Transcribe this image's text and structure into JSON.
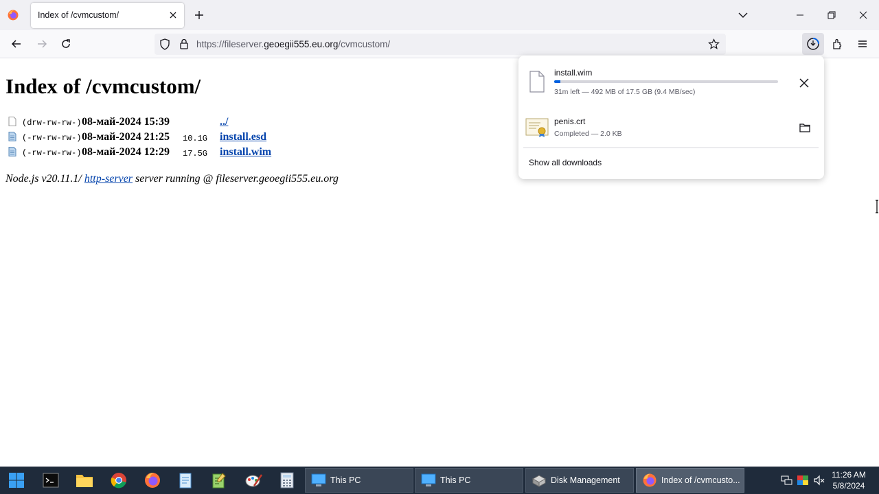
{
  "tab": {
    "title": "Index of /cvmcustom/"
  },
  "urlbar": {
    "scheme": "https://fileserver.",
    "host": "geoegii555.eu.org",
    "path": "/cvmcustom/"
  },
  "page": {
    "title": "Index of /cvmcustom/",
    "entries": [
      {
        "perm": "(drw-rw-rw-)",
        "date": "08-май-2024 15:39",
        "size": "",
        "name": "../",
        "icon": "blank-file-icon"
      },
      {
        "perm": "(-rw-rw-rw-)",
        "date": "08-май-2024 21:25",
        "size": "10.1G",
        "name": "install.esd",
        "icon": "file-icon"
      },
      {
        "perm": "(-rw-rw-rw-)",
        "date": "08-май-2024 12:29",
        "size": "17.5G",
        "name": "install.wim",
        "icon": "file-icon"
      }
    ],
    "footer": {
      "prefix": "Node.js v20.11.1/ ",
      "link": "http-server",
      "suffix": " server running @ fileserver.geoegii555.eu.org"
    }
  },
  "downloads": {
    "items": [
      {
        "name": "install.wim",
        "status": "31m left — 492 MB of 17.5 GB (9.4 MB/sec)",
        "progress": 0.028,
        "icon": "file-icon",
        "action_icon": "close-icon"
      },
      {
        "name": "penis.crt",
        "status": "Completed — 2.0 KB",
        "icon": "certificate-icon",
        "action_icon": "folder-icon"
      }
    ],
    "show_all": "Show all downloads"
  },
  "taskbar": {
    "pinned": [
      "start-icon",
      "terminal-icon",
      "file-explorer-icon",
      "chrome-icon",
      "firefox-icon",
      "notepad-icon",
      "notepad-plus-icon",
      "paint-icon",
      "calculator-icon"
    ],
    "tasks": [
      {
        "label": "This PC",
        "icon": "computer-icon",
        "active": false
      },
      {
        "label": "This PC",
        "icon": "computer-icon",
        "active": false
      },
      {
        "label": "Disk Management",
        "icon": "disk-icon",
        "active": false
      },
      {
        "label": "Index of /cvmcusto...",
        "icon": "firefox-icon",
        "active": true
      }
    ],
    "clock": {
      "time": "11:26 AM",
      "date": "5/8/2024"
    }
  },
  "colors": {
    "link": "#0645ad",
    "accent": "#0061e0",
    "taskbar": "#1f2b3b"
  }
}
